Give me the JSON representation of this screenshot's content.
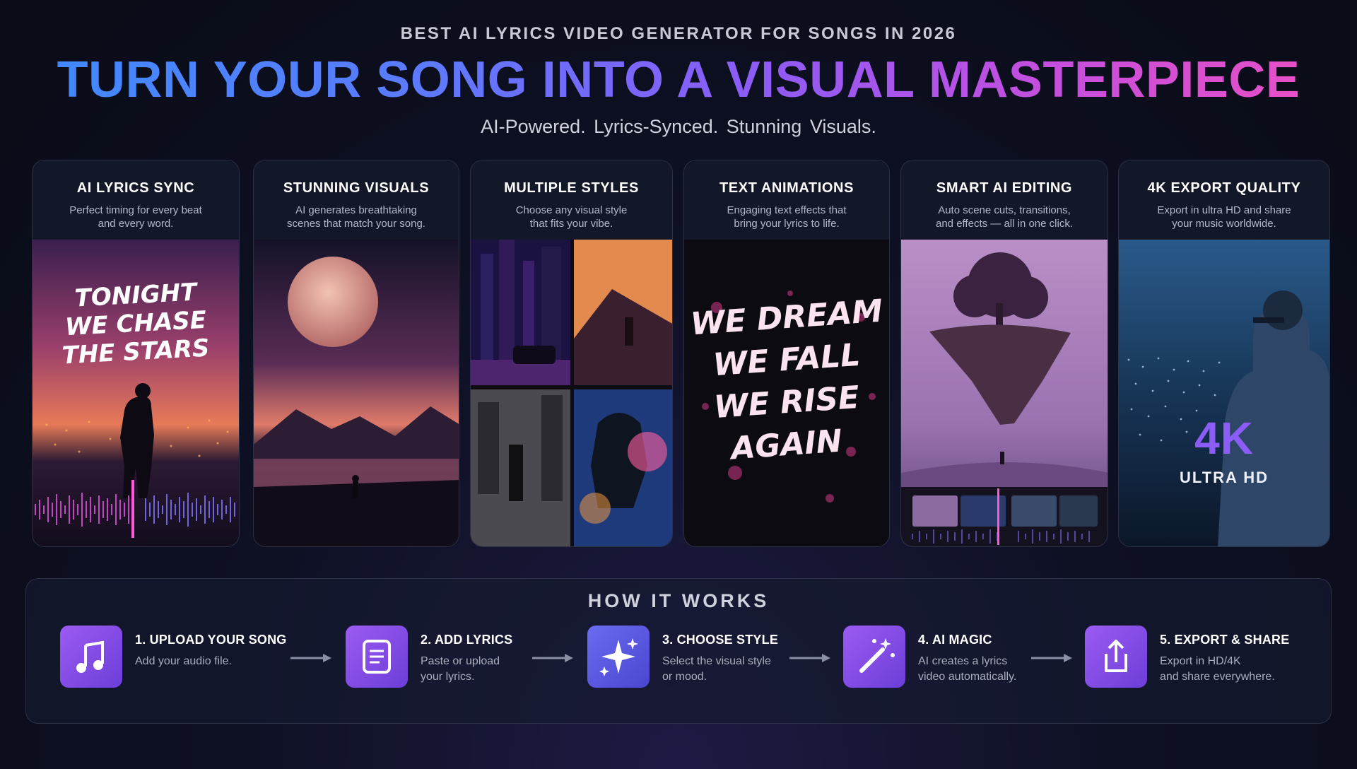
{
  "header": {
    "eyebrow": "BEST AI LYRICS VIDEO GENERATOR FOR SONGS IN 2026",
    "headline": "TURN YOUR SONG INTO A VISUAL MASTERPIECE",
    "tagline": "AI-Powered.  Lyrics-Synced.  Stunning Visuals."
  },
  "features": [
    {
      "title": "AI LYRICS SYNC",
      "desc_line1": "Perfect timing for every beat",
      "desc_line2": "and every word.",
      "lyric_lines": [
        "TONIGHT",
        "WE CHASE",
        "THE STARS"
      ]
    },
    {
      "title": "STUNNING VISUALS",
      "desc_line1": "AI generates breathtaking",
      "desc_line2": "scenes that match your song."
    },
    {
      "title": "MULTIPLE STYLES",
      "desc_line1": "Choose any visual style",
      "desc_line2": "that fits your vibe."
    },
    {
      "title": "TEXT ANIMATIONS",
      "desc_line1": "Engaging text effects that",
      "desc_line2": "bring your lyrics to life.",
      "lyric_lines": [
        "WE DREAM",
        "WE FALL",
        "WE RISE",
        "AGAIN"
      ]
    },
    {
      "title": "SMART AI EDITING",
      "desc_line1": "Auto scene cuts, transitions,",
      "desc_line2": "and effects — all in one click."
    },
    {
      "title": "4K EXPORT QUALITY",
      "desc_line1": "Export in ultra HD and share",
      "desc_line2": "your music worldwide.",
      "badge": "4K",
      "badge_sub": "ULTRA HD"
    }
  ],
  "how_it_works": {
    "title": "HOW IT WORKS",
    "steps": [
      {
        "title": "1.  UPLOAD YOUR SONG",
        "desc_line1": "Add your audio file.",
        "desc_line2": "",
        "icon": "music-note-icon"
      },
      {
        "title": "2.  ADD LYRICS",
        "desc_line1": "Paste or upload",
        "desc_line2": "your lyrics.",
        "icon": "document-icon"
      },
      {
        "title": "3.  CHOOSE STYLE",
        "desc_line1": "Select the visual style",
        "desc_line2": "or mood.",
        "icon": "sparkles-icon"
      },
      {
        "title": "4. AI MAGIC",
        "desc_line1": "AI creates a lyrics",
        "desc_line2": "video automatically.",
        "icon": "magic-wand-icon"
      },
      {
        "title": "5.  EXPORT & SHARE",
        "desc_line1": "Export in HD/4K",
        "desc_line2": "and share everywhere.",
        "icon": "share-upload-icon"
      }
    ]
  },
  "colors": {
    "background": "#0b0d1a",
    "headline_gradient_start": "#3d8bff",
    "headline_gradient_end": "#ee4fc2",
    "accent_purple": "#8b5cf6",
    "accent_pink": "#ff4fd8"
  }
}
